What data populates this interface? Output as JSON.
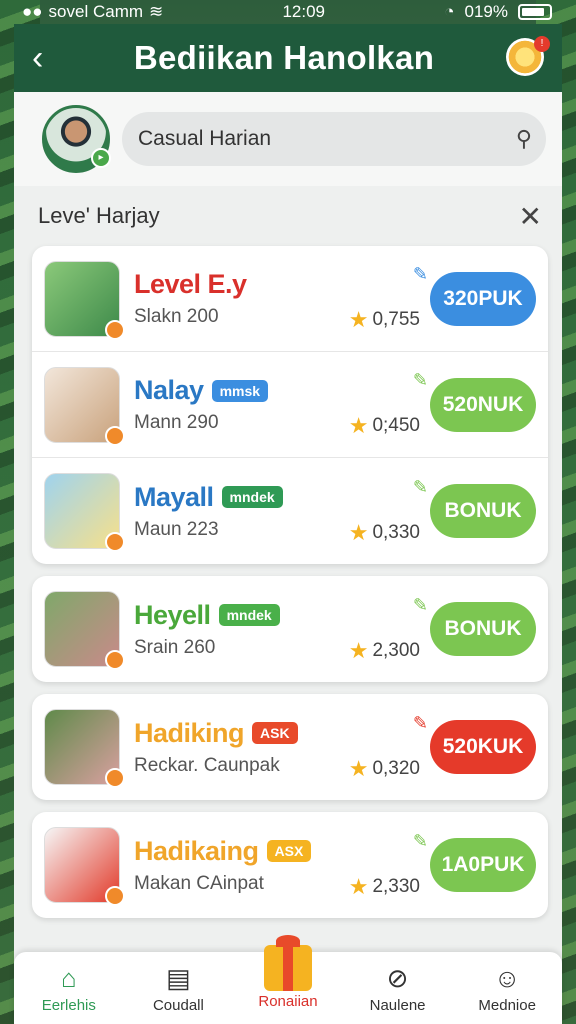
{
  "status": {
    "carrier": "sovel Camm",
    "time": "12:09",
    "battery": "019%"
  },
  "header": {
    "title": "Bediikan Hanolkan"
  },
  "search": {
    "placeholder": "Casual Harian"
  },
  "section": {
    "title": "Leve' Harjay"
  },
  "items": [
    {
      "name": "Level E.y",
      "tag": "",
      "sub": "Slakn 200",
      "score": "0,755",
      "cta": "320PUK",
      "name_color": "#d9302b",
      "cta_color": "#3b8ee0"
    },
    {
      "name": "Nalay",
      "tag": "mmsk",
      "sub": "Mann 290",
      "score": "0;450",
      "cta": "520NUK",
      "name_color": "#2a78c4",
      "tag_color": "#3b8ee0",
      "cta_color": "#7cc651"
    },
    {
      "name": "Mayall",
      "tag": "mndek",
      "sub": "Maun 223",
      "score": "0,330",
      "cta": "BONUK",
      "name_color": "#2a78c4",
      "tag_color": "#2f9a55",
      "cta_color": "#7cc651"
    },
    {
      "name": "Heyell",
      "tag": "mndek",
      "sub": "Srain 260",
      "score": "2,300",
      "cta": "BONUK",
      "name_color": "#4aa83a",
      "tag_color": "#4ab04a",
      "cta_color": "#7cc651"
    },
    {
      "name": "Hadiking",
      "tag": "ASK",
      "sub": "Reckar. Caunpak",
      "score": "0,320",
      "cta": "520KUK",
      "name_color": "#f0a52a",
      "tag_color": "#e84a2a",
      "cta_color": "#e53a2a"
    },
    {
      "name": "Hadikaing",
      "tag": "ASX",
      "sub": "Makan CAinpat",
      "score": "2,330",
      "cta": "1A0PUK",
      "name_color": "#f0a52a",
      "tag_color": "#f5b321",
      "cta_color": "#7cc651"
    }
  ],
  "nav": [
    {
      "label": "Eerlehis",
      "icon": "home-icon",
      "color": "#2f9a55"
    },
    {
      "label": "Coudall",
      "icon": "news-icon",
      "color": "#333"
    },
    {
      "label": "Ronaiian",
      "icon": "gift-icon",
      "color": "#d9302b"
    },
    {
      "label": "Naulene",
      "icon": "compass-icon",
      "color": "#333"
    },
    {
      "label": "Mednioe",
      "icon": "profile-icon",
      "color": "#333"
    }
  ]
}
